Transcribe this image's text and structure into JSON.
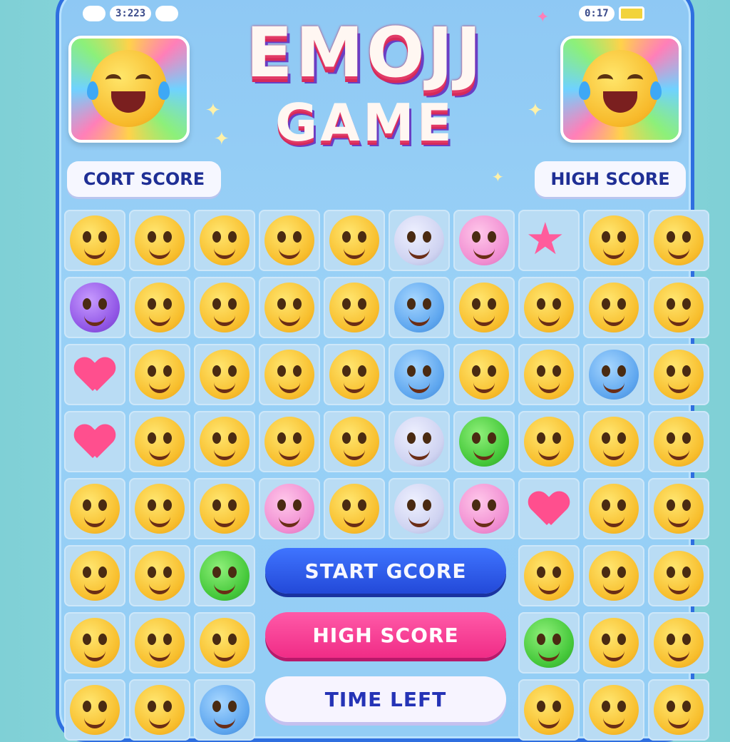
{
  "status_bar": {
    "left_time": "3:223",
    "right_time": "0:17"
  },
  "title": {
    "line1": "EMOJJ",
    "line2": "GAME"
  },
  "scores": {
    "current_label": "CORT SCORE",
    "high_label": "HIGH SCORE"
  },
  "buttons": {
    "start": "START GCORE",
    "high_score": "HIGH SCORE",
    "time_left": "TIME LEFT"
  },
  "colors": {
    "frame": "#2f6fe0",
    "title_shadow": "#e23b66",
    "start_button": "#2f5fe8",
    "high_button": "#f53c92",
    "score_text": "#1f2f95"
  },
  "board": {
    "rows": 8,
    "cols": 10,
    "cells": [
      [
        "blush-smile-icon",
        "grin-eyes-icon",
        "heart-eyes-icon",
        "shy-smile-icon",
        "tears-of-joy-icon",
        "lavender-face-icon",
        "pink-face-icon",
        "pink-star-icon",
        "grin-icon",
        "grin-eyes-icon"
      ],
      [
        "purple-devil-icon",
        "squint-grin-icon",
        "squint-grin-icon",
        "grin-icon",
        "grin-eyes-icon",
        "blue-face-icon",
        "kiss-icon",
        "squint-grin-icon",
        "grin-icon",
        "grin-icon"
      ],
      [
        "pink-heart-icon",
        "grin-eyes-icon",
        "tongue-out-icon",
        "laugh-icon",
        "heart-eyes-icon",
        "blue-heart-eyes-icon",
        "heart-eyes-icon",
        "heart-eyes-icon",
        "blue-cat-icon",
        "grin-icon"
      ],
      [
        "pink-heart-icon",
        "wink-icon",
        "smirk-icon",
        "kiss-icon",
        "tongue-out-icon",
        "lavender-face-icon",
        "green-face-icon",
        "grin-eyes-icon",
        "blush-smile-icon",
        "grin-icon"
      ],
      [
        "grin-eyes-icon",
        "shy-smile-icon",
        "wink-icon",
        "pink-face-icon",
        "grin-eyes-icon",
        "lavender-face-icon",
        "pink-face-icon",
        "pink-heart-icon",
        "grin-icon",
        "grin-icon"
      ],
      [
        "laugh-icon",
        "blush-smile-icon",
        "green-face-icon",
        "",
        "",
        "",
        "",
        "grin-eyes-icon",
        "laugh-icon",
        "grin-icon"
      ],
      [
        "blush-smile-icon",
        "sunglasses-icon",
        "shy-smile-icon",
        "",
        "",
        "",
        "",
        "green-face-icon",
        "laugh-icon",
        "grin-icon"
      ],
      [
        "grin-eyes-icon",
        "laugh-icon",
        "blue-face-icon",
        "",
        "",
        "",
        "",
        "grin-eyes-icon",
        "laugh-icon",
        "grin-eyes-icon"
      ]
    ]
  }
}
